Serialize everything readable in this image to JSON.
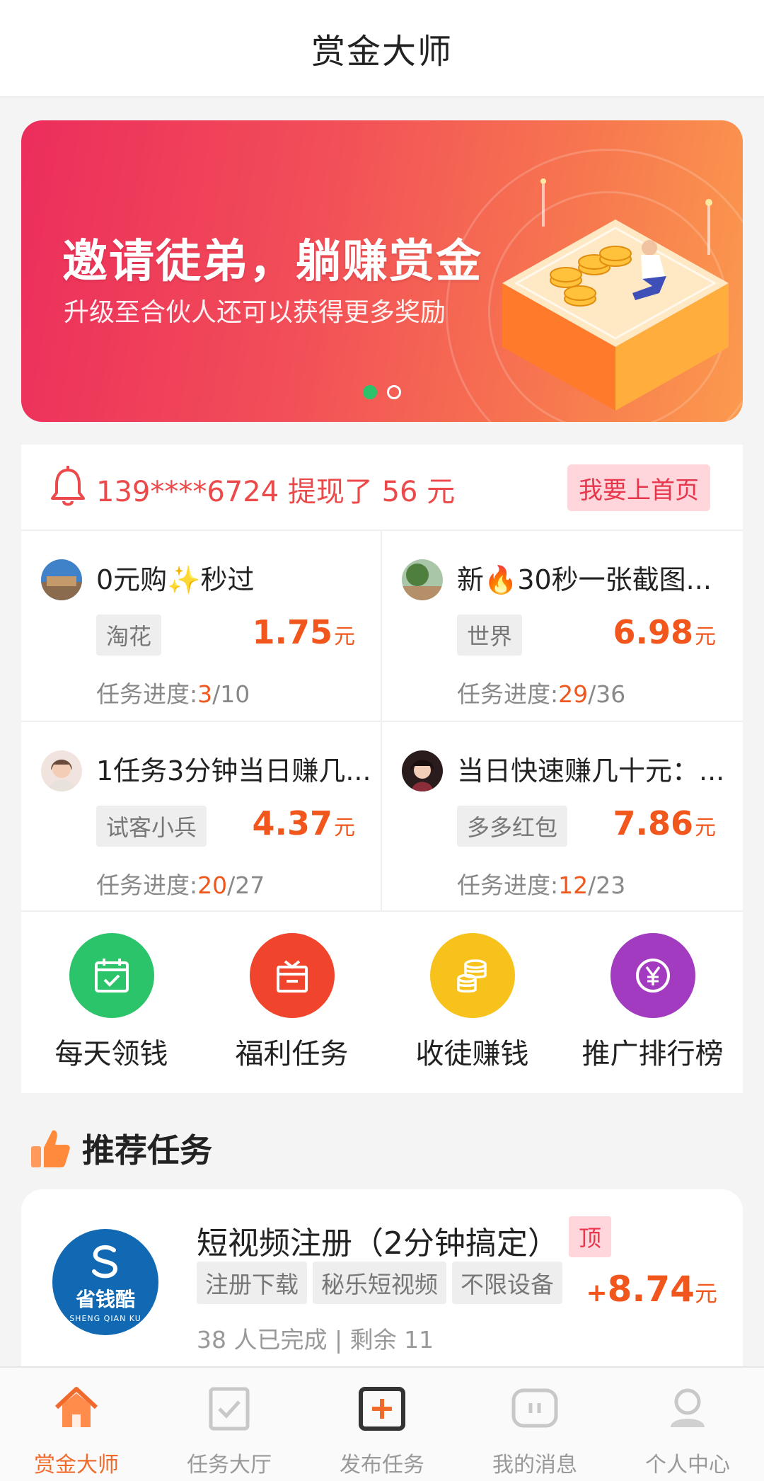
{
  "header": {
    "title": "赏金大师"
  },
  "banner": {
    "headline": "邀请徒弟，躺赚赏金",
    "subline": "升级至合伙人还可以获得更多奖励",
    "slide_count": 2,
    "active_slide": 1
  },
  "notice": {
    "text": "139****6724 提现了 56 元",
    "button": "我要上首页"
  },
  "tasks": [
    {
      "name": "0元购✨秒过",
      "tag": "淘花",
      "price": "1.75",
      "unit": "元",
      "progress_label": "任务进度:",
      "done": "3",
      "total": "/10"
    },
    {
      "name": "新🔥30秒一张截图...",
      "tag": "世界",
      "price": "6.98",
      "unit": "元",
      "progress_label": "任务进度:",
      "done": "29",
      "total": "/36"
    },
    {
      "name": "1任务3分钟当日赚几...",
      "tag": "试客小兵",
      "price": "4.37",
      "unit": "元",
      "progress_label": "任务进度:",
      "done": "20",
      "total": "/27"
    },
    {
      "name": "当日快速赚几十元：...",
      "tag": "多多红包",
      "price": "7.86",
      "unit": "元",
      "progress_label": "任务进度:",
      "done": "12",
      "total": "/23"
    }
  ],
  "shortcuts": [
    {
      "label": "每天领钱",
      "icon": "calendar-check-icon",
      "color": "#2cc46b"
    },
    {
      "label": "福利任务",
      "icon": "gift-box-icon",
      "color": "#f0452c"
    },
    {
      "label": "收徒赚钱",
      "icon": "coins-icon",
      "color": "#f7c21c"
    },
    {
      "label": "推广排行榜",
      "icon": "yen-icon",
      "color": "#a23bbf"
    }
  ],
  "recommend": {
    "section_title": "推荐任务",
    "item": {
      "logo_cn": "省钱酷",
      "logo_en": "SHENG QIAN KU",
      "title": "短视频注册（2分钟搞定）",
      "badge": "顶",
      "tags": [
        "注册下载",
        "秘乐短视频",
        "不限设备"
      ],
      "price_prefix": "+",
      "price": "8.74",
      "unit": "元",
      "meta": "38 人已完成 | 剩余 11"
    }
  },
  "tabbar": [
    {
      "label": "赏金大师",
      "icon": "home-icon",
      "active": true
    },
    {
      "label": "任务大厅",
      "icon": "task-check-icon",
      "active": false
    },
    {
      "label": "发布任务",
      "icon": "plus-box-icon",
      "active": false
    },
    {
      "label": "我的消息",
      "icon": "message-icon",
      "active": false
    },
    {
      "label": "个人中心",
      "icon": "user-icon",
      "active": false
    }
  ],
  "colors": {
    "accent": "#f1571c",
    "tab_active": "#f26a2b",
    "notice": "#ec4a4a"
  }
}
